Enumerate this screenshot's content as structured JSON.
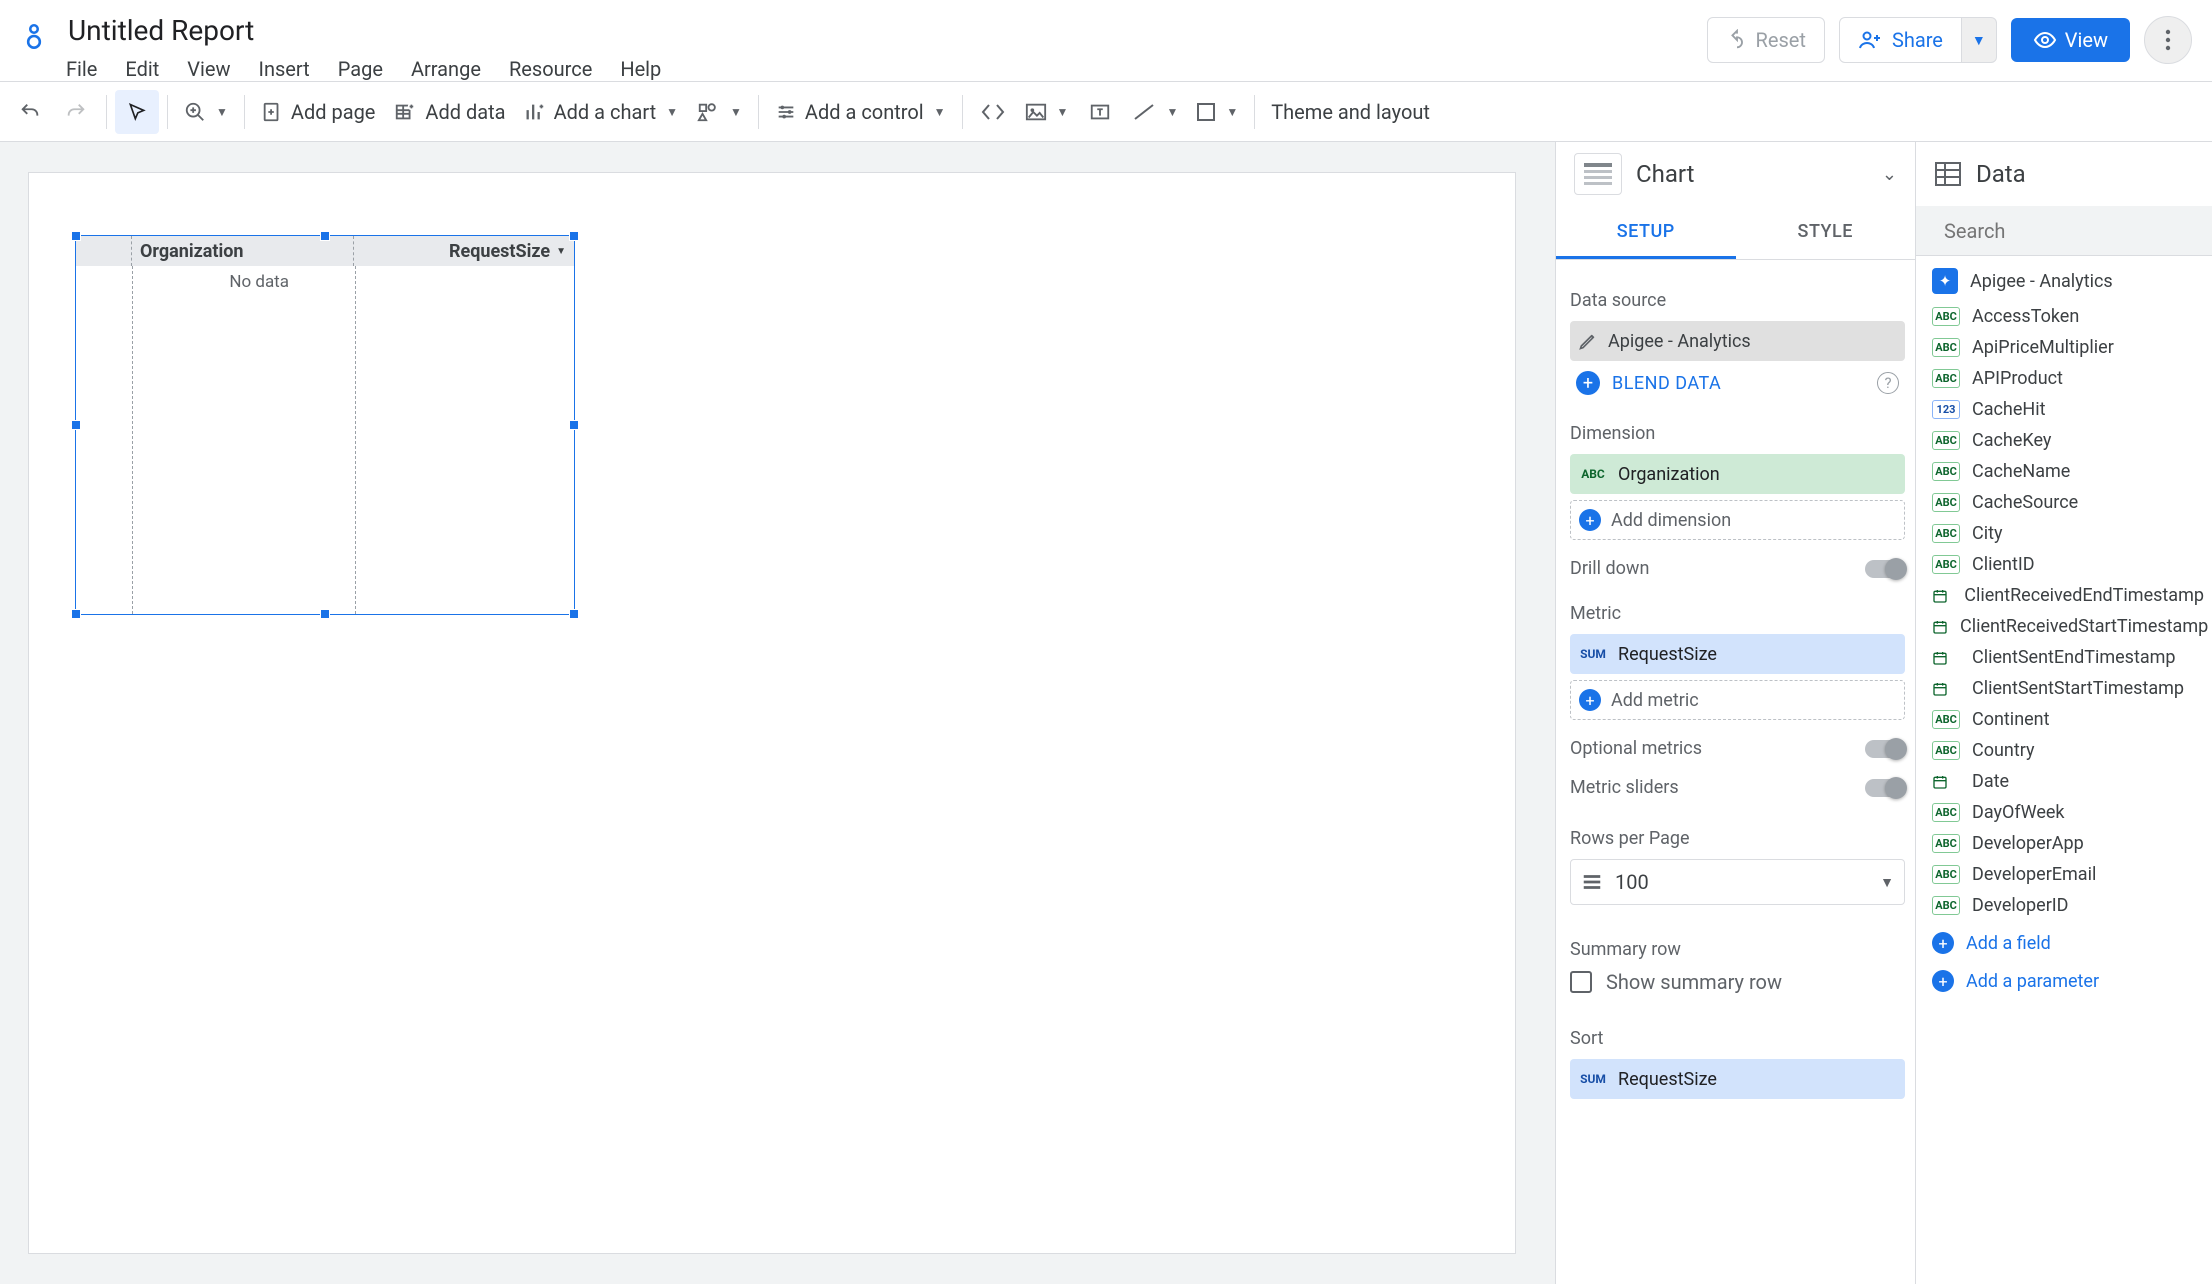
{
  "header": {
    "title": "Untitled Report",
    "menus": [
      "File",
      "Edit",
      "View",
      "Insert",
      "Page",
      "Arrange",
      "Resource",
      "Help"
    ],
    "reset": "Reset",
    "share": "Share",
    "view": "View"
  },
  "toolbar": {
    "add_page": "Add page",
    "add_data": "Add data",
    "add_chart": "Add a chart",
    "add_control": "Add a control",
    "theme": "Theme and layout"
  },
  "canvas": {
    "col1": "Organization",
    "col2": "RequestSize",
    "no_data": "No data"
  },
  "chart_panel": {
    "title": "Chart",
    "tab_setup": "SETUP",
    "tab_style": "STYLE",
    "data_source_label": "Data source",
    "data_source_value": "Apigee - Analytics",
    "blend": "BLEND DATA",
    "dimension_label": "Dimension",
    "dimension_value": "Organization",
    "add_dimension": "Add dimension",
    "drill_down": "Drill down",
    "metric_label": "Metric",
    "metric_value": "RequestSize",
    "add_metric": "Add metric",
    "optional_metrics": "Optional metrics",
    "metric_sliders": "Metric sliders",
    "rows_per_page": "Rows per Page",
    "rows_value": "100",
    "summary_row": "Summary row",
    "show_summary_row": "Show summary row",
    "sort": "Sort",
    "sort_value": "RequestSize"
  },
  "data_panel": {
    "title": "Data",
    "search_placeholder": "Search",
    "data_source": "Apigee - Analytics",
    "fields": [
      {
        "type": "abc",
        "name": "AccessToken"
      },
      {
        "type": "abc",
        "name": "ApiPriceMultiplier"
      },
      {
        "type": "abc",
        "name": "APIProduct"
      },
      {
        "type": "123",
        "name": "CacheHit"
      },
      {
        "type": "abc",
        "name": "CacheKey"
      },
      {
        "type": "abc",
        "name": "CacheName"
      },
      {
        "type": "abc",
        "name": "CacheSource"
      },
      {
        "type": "abc",
        "name": "City"
      },
      {
        "type": "abc",
        "name": "ClientID"
      },
      {
        "type": "date",
        "name": "ClientReceivedEndTimestamp"
      },
      {
        "type": "date",
        "name": "ClientReceivedStartTimestamp"
      },
      {
        "type": "date",
        "name": "ClientSentEndTimestamp"
      },
      {
        "type": "date",
        "name": "ClientSentStartTimestamp"
      },
      {
        "type": "abc",
        "name": "Continent"
      },
      {
        "type": "abc",
        "name": "Country"
      },
      {
        "type": "date",
        "name": "Date"
      },
      {
        "type": "abc",
        "name": "DayOfWeek"
      },
      {
        "type": "abc",
        "name": "DeveloperApp"
      },
      {
        "type": "abc",
        "name": "DeveloperEmail"
      },
      {
        "type": "abc",
        "name": "DeveloperID"
      }
    ],
    "add_field": "Add a field",
    "add_parameter": "Add a parameter"
  }
}
